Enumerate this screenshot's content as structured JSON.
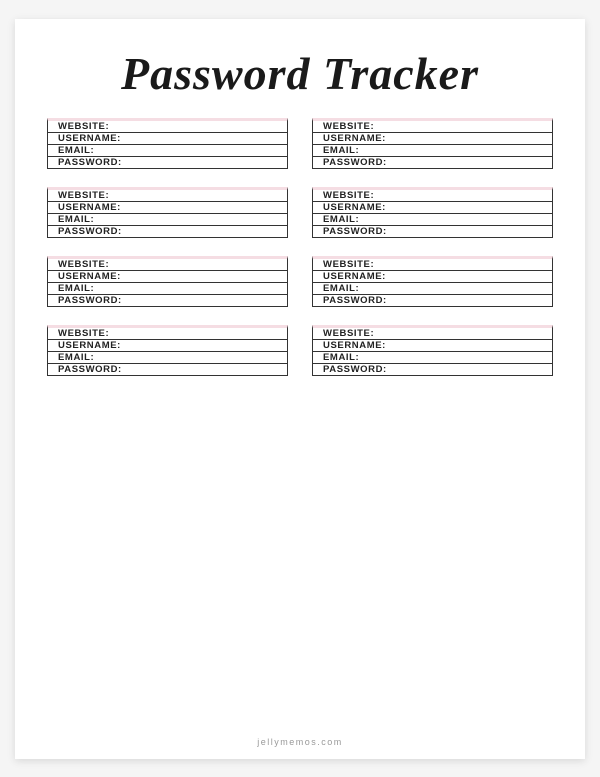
{
  "title": "Password Tracker",
  "fields": {
    "website": "WEBSITE:",
    "username": "USERNAME:",
    "email": "EMAIL:",
    "password": "PASSWORD:"
  },
  "footer": "jellymemos.com",
  "colors": {
    "accent": "#f5dde3",
    "border": "#333"
  },
  "card_count": 8
}
